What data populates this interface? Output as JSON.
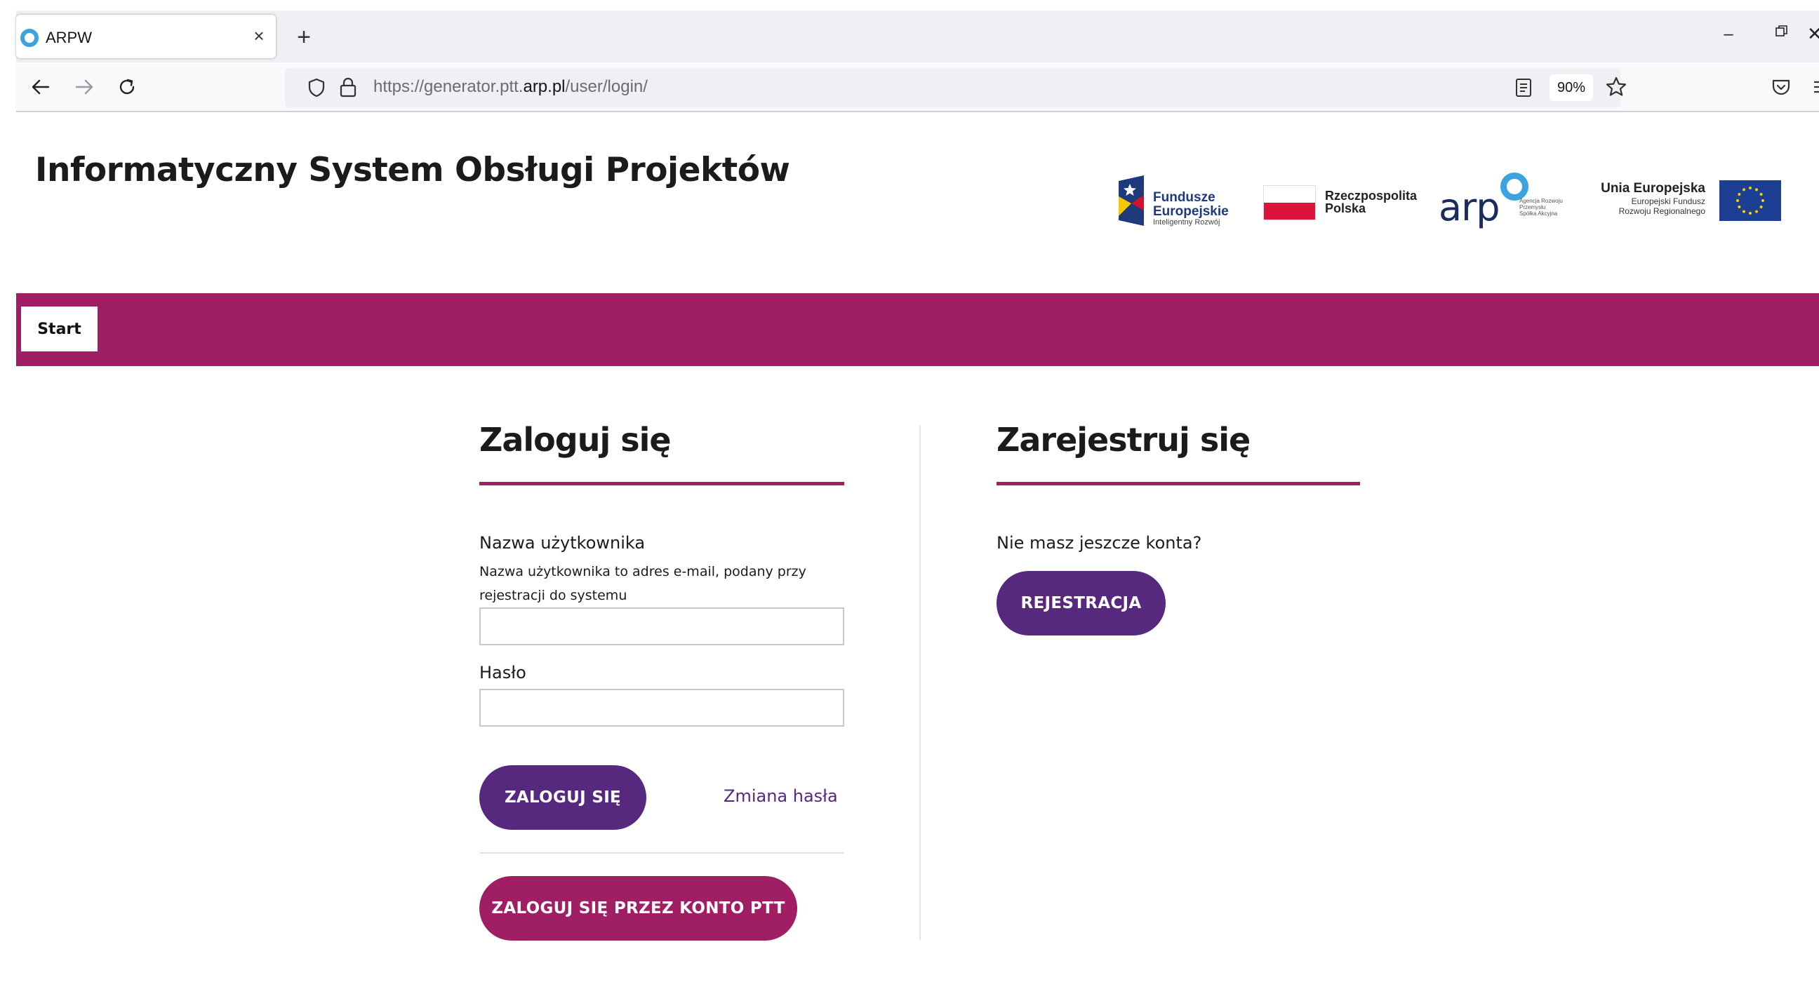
{
  "browser": {
    "tab_title": "ARPW",
    "tab_close": "×",
    "new_tab": "+",
    "url_prefix": "https://generator.ptt.",
    "url_domain": "arp.pl",
    "url_path": "/user/login/",
    "zoom": "90%",
    "window_minimize": "–",
    "window_close": "✕"
  },
  "header": {
    "title": "Informatyczny System Obsługi Projektów",
    "logos": {
      "fe_line1": "Fundusze",
      "fe_line2": "Europejskie",
      "fe_line3": "Inteligentny Rozwój",
      "rp_line1": "Rzeczpospolita",
      "rp_line2": "Polska",
      "arp_word": "arp",
      "arp_small1": "Agencja Rozwoju",
      "arp_small2": "Przemysłu",
      "arp_small3": "Spółka Akcyjna",
      "ue_line1": "Unia Europejska",
      "ue_line2": "Europejski Fundusz",
      "ue_line3": "Rozwoju Regionalnego"
    }
  },
  "nav": {
    "start_label": "Start"
  },
  "login": {
    "title": "Zaloguj się",
    "username_label": "Nazwa użytkownika",
    "username_hint": "Nazwa użytkownika to adres e-mail, podany przy rejestracji do systemu",
    "username_value": "",
    "password_label": "Hasło",
    "password_value": "",
    "submit_label": "ZALOGUJ SIĘ",
    "change_password_link": "Zmiana hasła",
    "ptt_login_label": "ZALOGUJ SIĘ PRZEZ KONTO PTT"
  },
  "register": {
    "title": "Zarejestruj się",
    "prompt": "Nie masz jeszcze konta?",
    "button_label": "REJESTRACJA"
  },
  "colors": {
    "brand_magenta": "#a01e64",
    "brand_purple": "#56287e"
  }
}
